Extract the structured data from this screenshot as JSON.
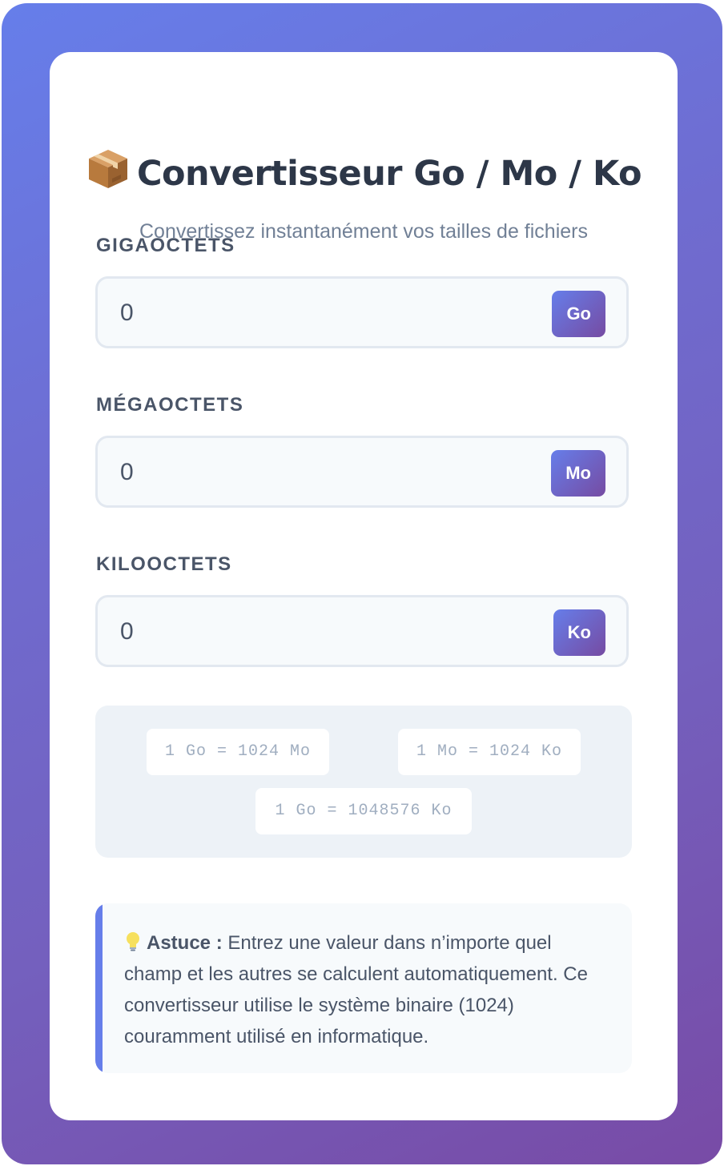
{
  "header": {
    "emoji": "📦",
    "title": "Convertisseur Go / Mo / Ko",
    "subtitle": "Convertissez instantanément vos tailles de fichiers"
  },
  "fields": [
    {
      "label": "GIGAOCTETS",
      "value": "0",
      "unit": "Go"
    },
    {
      "label": "MÉGAOCTETS",
      "value": "0",
      "unit": "Mo"
    },
    {
      "label": "KILOOCTETS",
      "value": "0",
      "unit": "Ko"
    }
  ],
  "formulas": [
    "1 Go = 1024 Mo",
    "1 Mo = 1024 Ko",
    "1 Go = 1048576 Ko"
  ],
  "tip": {
    "icon": "lightbulb-icon",
    "bold": "Astuce :",
    "text": "Entrez une valeur dans n’importe quel champ et les autres se calculent automatiquement. Ce convertisseur utilise le système binaire (1024) couramment utilisé en informatique."
  },
  "colors": {
    "accent_start": "#667eea",
    "accent_end": "#764ba2",
    "title": "#2d3748",
    "label": "#4a5568"
  }
}
